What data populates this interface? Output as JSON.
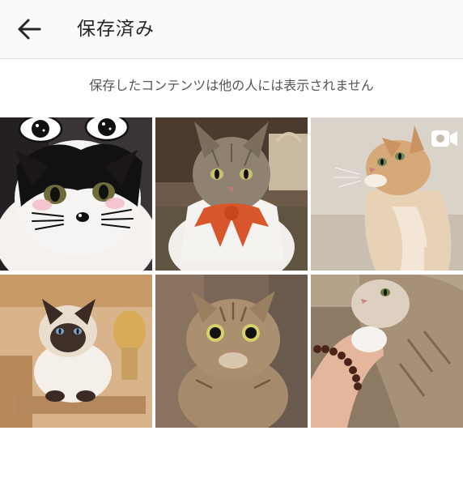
{
  "header": {
    "back_icon": "arrow-left-icon",
    "title": "保存済み"
  },
  "notice": "保存したコンテンツは他の人には表示されません",
  "saved_posts": [
    {
      "subject": "black-and-white cat with cartoon eyes and whiskers filter",
      "media": "photo"
    },
    {
      "subject": "tabby cat wearing orange bow and white cape",
      "media": "photo"
    },
    {
      "subject": "orange cat looking up",
      "media": "video",
      "badge_icon": "video-camera-icon"
    },
    {
      "subject": "siamese cat on a wooden shelf",
      "media": "photo"
    },
    {
      "subject": "round-eyed tabby cat",
      "media": "photo"
    },
    {
      "subject": "cat resting on a person's arm with bead bracelet",
      "media": "photo"
    }
  ]
}
